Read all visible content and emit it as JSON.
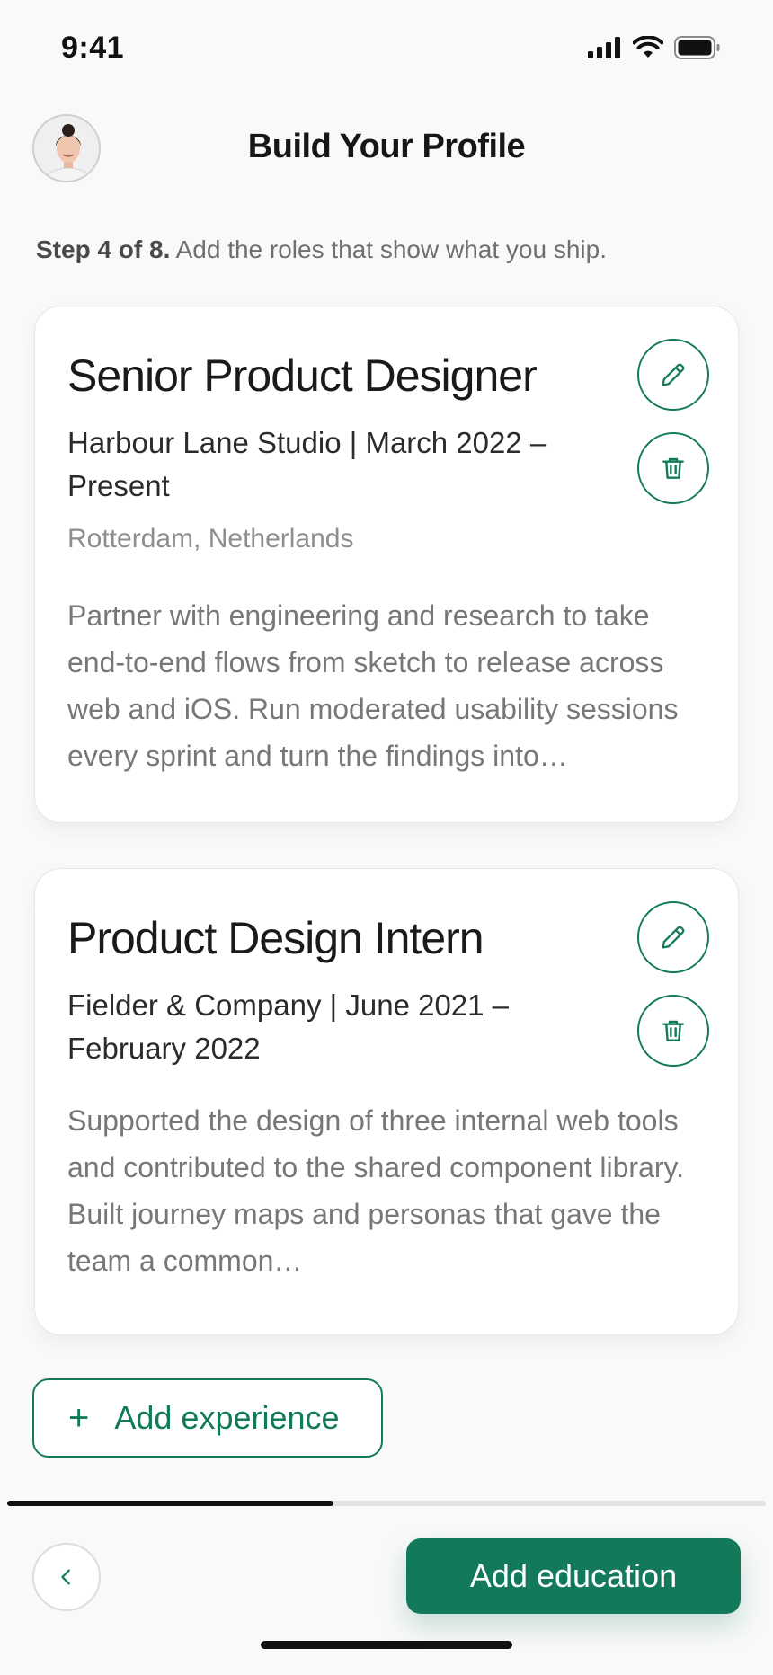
{
  "status_bar": {
    "time": "9:41"
  },
  "header": {
    "title": "Build Your Profile"
  },
  "step": {
    "prefix": "Step 4 of 8.",
    "text": " Add the roles that show what you ship."
  },
  "experiences": [
    {
      "title": "Senior Product Designer",
      "company_dates": "Harbour Lane Studio | March 2022 – Present",
      "location": "Rotterdam, Netherlands",
      "description": "Partner with engineering and research to take end-to-end flows from sketch to release across web and iOS. Run moderated usability sessions every sprint and turn the findings into…"
    },
    {
      "title": "Product Design Intern",
      "company_dates": "Fielder & Company | June 2021 – February 2022",
      "description": "Supported the design of three internal web tools and contributed to the shared component library. Built journey maps and personas that gave the team a common…"
    }
  ],
  "add_experience": {
    "plus": "+",
    "label": "Add experience"
  },
  "progress": {
    "fraction": 0.43
  },
  "footer": {
    "primary_label": "Add education"
  },
  "colors": {
    "accent": "#127a5b",
    "background": "#f9f9f9"
  }
}
